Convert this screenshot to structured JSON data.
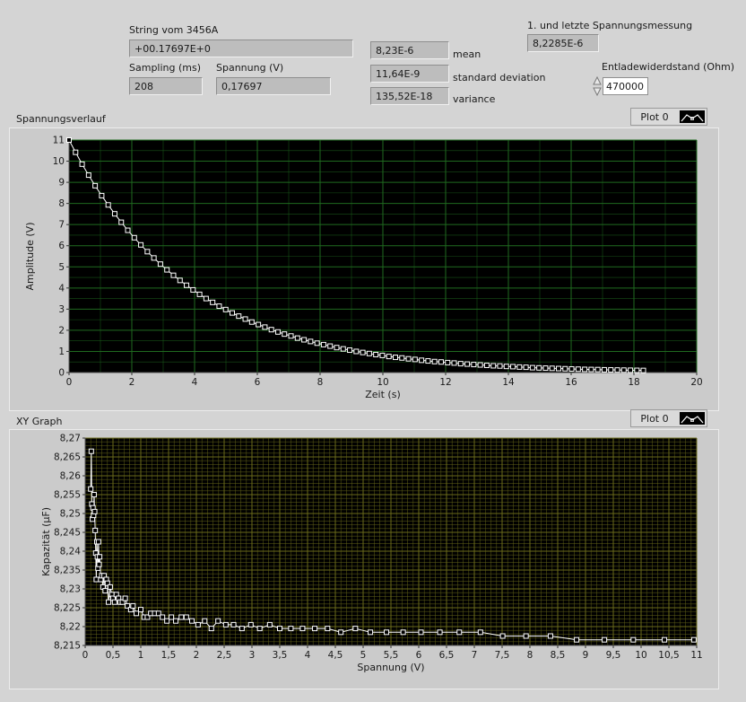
{
  "controls": {
    "string_label": "String vom 3456A",
    "string_value": "+00.17697E+0",
    "sampling_label": "Sampling (ms)",
    "sampling_value": "208",
    "spannung_label": "Spannung (V)",
    "spannung_value": "0,17697",
    "mean_value": "8,23E-6",
    "mean_label": "mean",
    "stddev_value": "11,64E-9",
    "stddev_label": "standard deviation",
    "variance_value": "135,52E-18",
    "variance_label": "variance",
    "measure_label": "1. und letzte Spannungsmessung",
    "measure_value": "8,2285E-6",
    "resistor_label": "Entladewiderdstand (Ohm)",
    "resistor_value": "470000"
  },
  "graph1": {
    "caption": "Spannungsverlauf",
    "legend": "Plot 0"
  },
  "graph2": {
    "caption": "XY Graph",
    "legend": "Plot 0"
  },
  "colors": {
    "plot_bg": "#000000",
    "grid1": "#1f6a1f",
    "grid2": "#6a6a1a",
    "trace": "#ffffff",
    "panel": "#cbcbcb"
  },
  "chart_data": [
    {
      "type": "line",
      "title": "Spannungsverlauf",
      "xlabel": "Zeit (s)",
      "ylabel": "Amplitude (V)",
      "xlim": [
        0,
        20
      ],
      "ylim": [
        0,
        11
      ],
      "xticks": [
        "0",
        "2",
        "4",
        "6",
        "8",
        "10",
        "12",
        "14",
        "16",
        "18",
        "20"
      ],
      "yticks": [
        "0",
        "1",
        "2",
        "3",
        "4",
        "5",
        "6",
        "7",
        "8",
        "9",
        "10",
        "11"
      ],
      "grid": true,
      "x": [
        0,
        0.208,
        0.416,
        0.624,
        0.832,
        1.04,
        1.248,
        1.456,
        1.664,
        1.872,
        2.08,
        2.288,
        2.496,
        2.704,
        2.912,
        3.12,
        3.328,
        3.536,
        3.744,
        3.952,
        4.16,
        4.368,
        4.576,
        4.784,
        4.992,
        5.2,
        5.408,
        5.616,
        5.824,
        6.032,
        6.24,
        6.448,
        6.656,
        6.864,
        7.072,
        7.28,
        7.488,
        7.696,
        7.904,
        8.112,
        8.32,
        8.528,
        8.736,
        8.944,
        9.152,
        9.36,
        9.568,
        9.776,
        9.984,
        10.192,
        10.4,
        10.608,
        10.816,
        11.024,
        11.232,
        11.44,
        11.648,
        11.856,
        12.064,
        12.272,
        12.48,
        12.688,
        12.896,
        13.104,
        13.312,
        13.52,
        13.728,
        13.936,
        14.144,
        14.352,
        14.56,
        14.768,
        14.976,
        15.184,
        15.392,
        15.6,
        15.808,
        16.016,
        16.224,
        16.432,
        16.64,
        16.848,
        17.056,
        17.264,
        17.472,
        17.68,
        17.888,
        18.096,
        18.3
      ],
      "values": [
        11,
        10.42,
        9.86,
        9.34,
        8.84,
        8.37,
        7.93,
        7.51,
        7.11,
        6.73,
        6.38,
        6.04,
        5.72,
        5.42,
        5.13,
        4.86,
        4.6,
        4.36,
        4.13,
        3.91,
        3.7,
        3.5,
        3.32,
        3.14,
        2.98,
        2.82,
        2.67,
        2.53,
        2.39,
        2.27,
        2.15,
        2.03,
        1.92,
        1.82,
        1.73,
        1.63,
        1.55,
        1.47,
        1.39,
        1.32,
        1.25,
        1.18,
        1.12,
        1.06,
        1,
        0.95,
        0.9,
        0.85,
        0.81,
        0.76,
        0.72,
        0.69,
        0.65,
        0.62,
        0.58,
        0.55,
        0.52,
        0.5,
        0.47,
        0.45,
        0.42,
        0.4,
        0.38,
        0.36,
        0.34,
        0.32,
        0.31,
        0.29,
        0.28,
        0.26,
        0.25,
        0.23,
        0.22,
        0.21,
        0.2,
        0.19,
        0.18,
        0.17,
        0.16,
        0.15,
        0.145,
        0.14,
        0.13,
        0.125,
        0.12,
        0.115,
        0.11,
        0.105,
        0.1
      ]
    },
    {
      "type": "scatter",
      "title": "XY Graph",
      "xlabel": "Spannung (V)",
      "ylabel": "Kapazität (µF)",
      "xlim": [
        0,
        11
      ],
      "ylim": [
        8.215,
        8.27
      ],
      "xticks": [
        "0",
        "0,5",
        "1",
        "1,5",
        "2",
        "2,5",
        "3",
        "3,5",
        "4",
        "4,5",
        "5",
        "5,5",
        "6",
        "6,5",
        "7",
        "7,5",
        "8",
        "8,5",
        "9",
        "9,5",
        "10",
        "10,5",
        "11"
      ],
      "yticks": [
        "8,215",
        "8,22",
        "8,225",
        "8,23",
        "8,235",
        "8,24",
        "8,245",
        "8,25",
        "8,255",
        "8,26",
        "8,265",
        "8,27"
      ],
      "grid": true,
      "x": [
        0.1,
        0.11,
        0.12,
        0.13,
        0.14,
        0.15,
        0.16,
        0.17,
        0.18,
        0.19,
        0.2,
        0.21,
        0.22,
        0.23,
        0.24,
        0.25,
        0.26,
        0.28,
        0.3,
        0.32,
        0.34,
        0.36,
        0.38,
        0.4,
        0.42,
        0.45,
        0.48,
        0.5,
        0.53,
        0.56,
        0.6,
        0.63,
        0.67,
        0.72,
        0.76,
        0.82,
        0.86,
        0.92,
        1.0,
        1.06,
        1.12,
        1.18,
        1.25,
        1.32,
        1.39,
        1.47,
        1.55,
        1.63,
        1.73,
        1.82,
        1.92,
        2.03,
        2.15,
        2.27,
        2.39,
        2.53,
        2.67,
        2.82,
        2.98,
        3.14,
        3.32,
        3.5,
        3.7,
        3.91,
        4.13,
        4.36,
        4.6,
        4.86,
        5.13,
        5.42,
        5.72,
        6.04,
        6.38,
        6.73,
        7.11,
        7.51,
        7.93,
        8.37,
        8.84,
        9.34,
        9.86,
        10.42,
        10.95
      ],
      "values": [
        8.2565,
        8.2665,
        8.2525,
        8.2485,
        8.2515,
        8.2495,
        8.255,
        8.2505,
        8.2455,
        8.2395,
        8.2325,
        8.2425,
        8.2385,
        8.2355,
        8.2425,
        8.2365,
        8.2385,
        8.2325,
        8.2335,
        8.2305,
        8.2335,
        8.2295,
        8.2325,
        8.2315,
        8.2265,
        8.2305,
        8.2285,
        8.2275,
        8.2265,
        8.2285,
        8.2275,
        8.2265,
        8.2265,
        8.2275,
        8.2255,
        8.2245,
        8.2255,
        8.2235,
        8.2245,
        8.2225,
        8.2225,
        8.2235,
        8.2235,
        8.2235,
        8.2225,
        8.2215,
        8.2225,
        8.2215,
        8.2225,
        8.2225,
        8.2215,
        8.2205,
        8.2215,
        8.2195,
        8.2215,
        8.2205,
        8.2205,
        8.2195,
        8.2205,
        8.2195,
        8.2205,
        8.2195,
        8.2195,
        8.2195,
        8.2195,
        8.2195,
        8.2185,
        8.2195,
        8.2185,
        8.2185,
        8.2185,
        8.2185,
        8.2185,
        8.2185,
        8.2185,
        8.2175,
        8.2175,
        8.2175,
        8.2165,
        8.2165,
        8.2165,
        8.2165,
        8.2165
      ]
    }
  ]
}
